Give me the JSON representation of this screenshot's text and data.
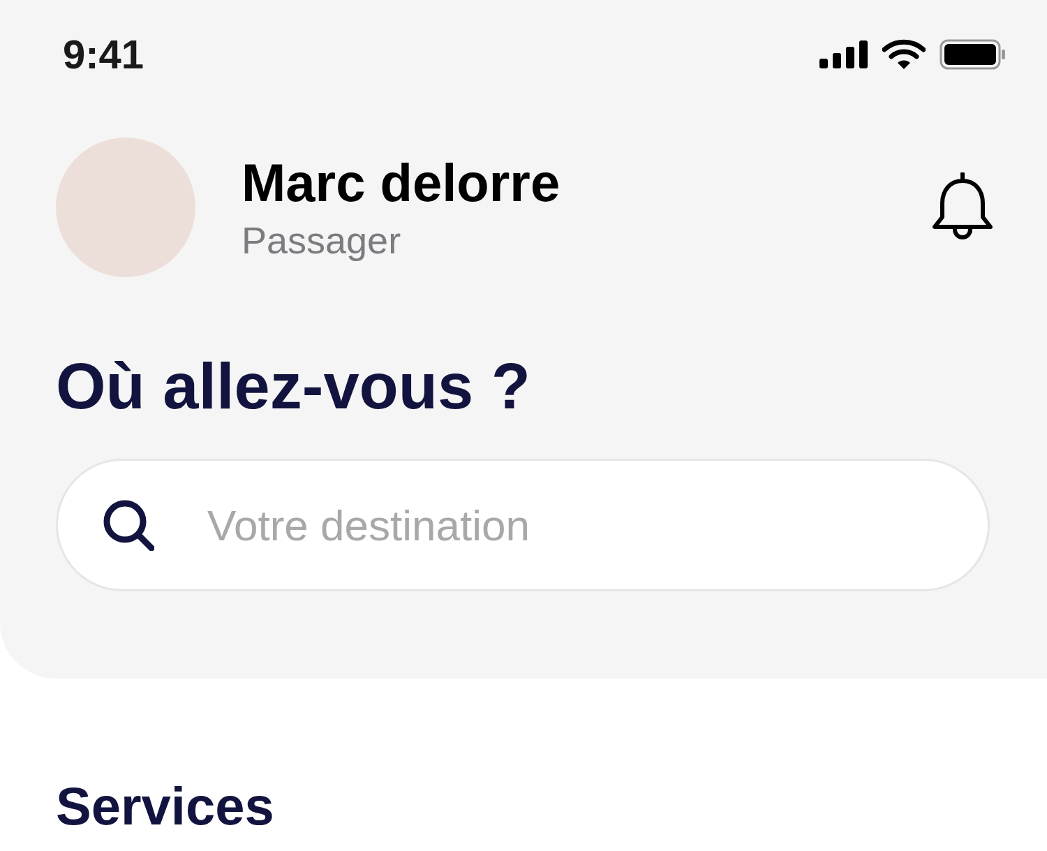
{
  "status_bar": {
    "time": "9:41"
  },
  "profile": {
    "name": "Marc delorre",
    "role": "Passager"
  },
  "heading": "Où allez-vous ?",
  "search": {
    "placeholder": "Votre destination"
  },
  "section_title": "Services"
}
